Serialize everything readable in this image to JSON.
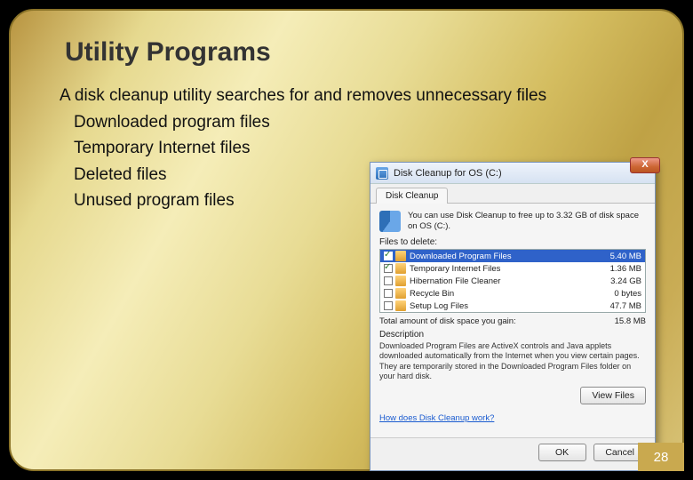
{
  "slide": {
    "title": "Utility Programs",
    "main_bullet": "A disk cleanup utility searches for and removes unnecessary files",
    "sub_bullets": [
      "Downloaded program files",
      "Temporary Internet files",
      "Deleted files",
      "Unused program files"
    ],
    "page_number": "28"
  },
  "dialog": {
    "title": "Disk Cleanup for OS (C:)",
    "close_label": "X",
    "tab_label": "Disk Cleanup",
    "info_text": "You can use Disk Cleanup to free up to 3.32 GB of disk space on OS (C:).",
    "files_label": "Files to delete:",
    "files": [
      {
        "name": "Downloaded Program Files",
        "size": "5.40 MB",
        "checked": true,
        "selected": true
      },
      {
        "name": "Temporary Internet Files",
        "size": "1.36 MB",
        "checked": true,
        "selected": false
      },
      {
        "name": "Hibernation File Cleaner",
        "size": "3.24 GB",
        "checked": false,
        "selected": false
      },
      {
        "name": "Recycle Bin",
        "size": "0 bytes",
        "checked": false,
        "selected": false
      },
      {
        "name": "Setup Log Files",
        "size": "47.7 MB",
        "checked": false,
        "selected": false
      }
    ],
    "total_label": "Total amount of disk space you gain:",
    "total_value": "15.8 MB",
    "desc_title": "Description",
    "desc_text": "Downloaded Program Files are ActiveX controls and Java applets downloaded automatically from the Internet when you view certain pages. They are temporarily stored in the Downloaded Program Files folder on your hard disk.",
    "view_files_btn": "View Files",
    "help_link": "How does Disk Cleanup work?",
    "ok_btn": "OK",
    "cancel_btn": "Cancel"
  }
}
